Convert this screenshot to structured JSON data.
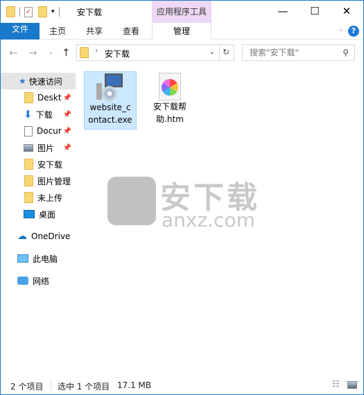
{
  "window": {
    "title": "安下载",
    "context_tab": "应用程序工具",
    "context_sub": "管理"
  },
  "ribbon": {
    "tabs": [
      "文件",
      "主页",
      "共享",
      "查看"
    ],
    "help": "?"
  },
  "address": {
    "path": "安下载",
    "search_placeholder": "搜索\"安下载\""
  },
  "sidebar": {
    "quick_access": "快速访问",
    "items": [
      {
        "label": "Deskt",
        "icon": "folder-icon",
        "pinned": true
      },
      {
        "label": "下载",
        "icon": "download-icon",
        "pinned": true
      },
      {
        "label": "Docur",
        "icon": "document-icon",
        "pinned": true
      },
      {
        "label": "图片",
        "icon": "pictures-icon",
        "pinned": true
      },
      {
        "label": "安下载",
        "icon": "folder-icon",
        "pinned": false
      },
      {
        "label": "图片管理",
        "icon": "folder-icon",
        "pinned": false
      },
      {
        "label": "未上传",
        "icon": "folder-icon",
        "pinned": false
      },
      {
        "label": "桌面",
        "icon": "desktop-icon",
        "pinned": false
      }
    ],
    "onedrive": "OneDrive",
    "thispc": "此电脑",
    "network": "网络"
  },
  "files": [
    {
      "name1": "website_c",
      "name2": "ontact.exe",
      "selected": true
    },
    {
      "name1": "安下载帮",
      "name2": "助.htm",
      "selected": false
    }
  ],
  "watermark": {
    "cn": "安下载",
    "en": "anxz.com"
  },
  "status": {
    "count": "2 个项目",
    "selected": "选中 1 个项目",
    "size": "17.1 MB"
  }
}
